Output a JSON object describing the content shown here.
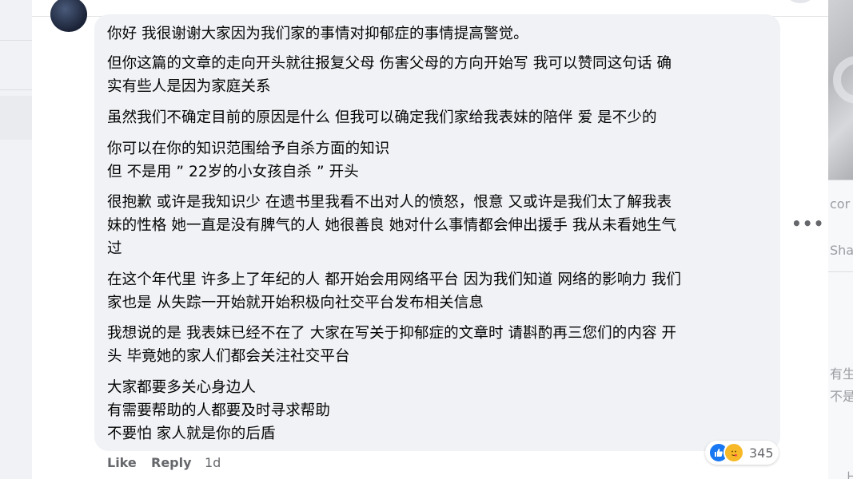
{
  "comment": {
    "paragraphs": [
      [
        "你好 我很谢谢大家因为我们家的事情对抑郁症的事情提高警觉。"
      ],
      [
        "但你这篇的文章的走向开头就往报复父母 伤害父母的方向开始写 我可以赞同这句话 确",
        "实有些人是因为家庭关系"
      ],
      [
        "虽然我们不确定目前的原因是什么 但我可以确定我们家给我表妹的陪伴 爱 是不少的"
      ],
      [
        "你可以在你的知识范围给予自杀方面的知识",
        "但 不是用 ” 22岁的小女孩自杀 ” 开头"
      ],
      [
        "很抱歉 或许是我知识少 在遗书里我看不出对人的愤怒，恨意 又或许是我们太了解我表",
        "妹的性格 她一直是没有脾气的人 她很善良 她对什么事情都会伸出援手 我从未看她生气",
        "过"
      ],
      [
        "在这个年代里 许多上了年纪的人 都开始会用网络平台 因为我们知道 网络的影响力 我们",
        "家也是 从失踪一开始就开始积极向社交平台发布相关信息"
      ],
      [
        "我想说的是 我表妹已经不在了 大家在写关于抑郁症的文章时 请斟酌再三您们的内容 开",
        "头 毕竟她的家人们都会关注社交平台"
      ],
      [
        "大家都要多关心身边人",
        "有需要帮助的人都要及时寻求帮助",
        "不要怕 家人就是你的后盾"
      ]
    ],
    "actions": {
      "like": "Like",
      "reply": "Reply",
      "time": "1d"
    },
    "reactions": {
      "icons": [
        "like-icon",
        "care-icon"
      ],
      "count": "345"
    }
  },
  "side": {
    "frag1": "cor",
    "frag2": "Sha",
    "frag3": "有生",
    "frag4": "不是",
    "frag5": "，上"
  },
  "colors": {
    "bubble": "#f0f2f5",
    "text": "#050505",
    "meta": "#65676b",
    "like_blue": "#1877f2"
  }
}
